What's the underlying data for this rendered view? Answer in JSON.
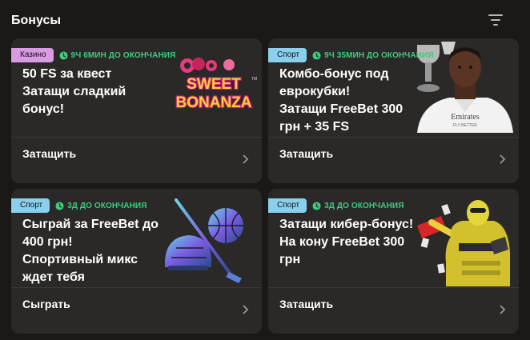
{
  "header": {
    "title": "Бонусы",
    "filter_icon": "filter-icon"
  },
  "cards": [
    {
      "category": "Казино",
      "timer": "9Ч 6МИН ДО ОКОНЧАНИЯ",
      "title": "50 FS за квест\nЗатащи сладкий\nбонус!",
      "action": "Затащить",
      "art": {
        "logo_line1": "SWEET",
        "logo_line2": "BONANZA",
        "logo_tm": "TM"
      }
    },
    {
      "category": "Спорт",
      "timer": "9Ч 35МИН ДО ОКОНЧАНИЯ",
      "title": "Комбо-бонус под\nеврокубки!\nЗатащи FreeBet 300\nгрн + 35 FS",
      "action": "Затащить",
      "art": {
        "shirt_sponsor": "Emirates",
        "shirt_sub": "FLY BETTER"
      }
    },
    {
      "category": "Спорт",
      "timer": "3Д ДО ОКОНЧАНИЯ",
      "title": "Сыграй за FreeBet до\n400 грн!\nСпортивный микс\nждет тебя",
      "action": "Сыграть"
    },
    {
      "category": "Спорт",
      "timer": "3Д ДО ОКОНЧАНИЯ",
      "title": "Затащи кибер-бонус!\nНа кону FreeBet 300\nгрн",
      "action": "Затащить"
    }
  ],
  "colors": {
    "casino_badge": "#d89be4",
    "sport_badge": "#8ad0ee",
    "timer": "#3ecb7d",
    "card": "#2a2927",
    "page": "#1a1918"
  }
}
